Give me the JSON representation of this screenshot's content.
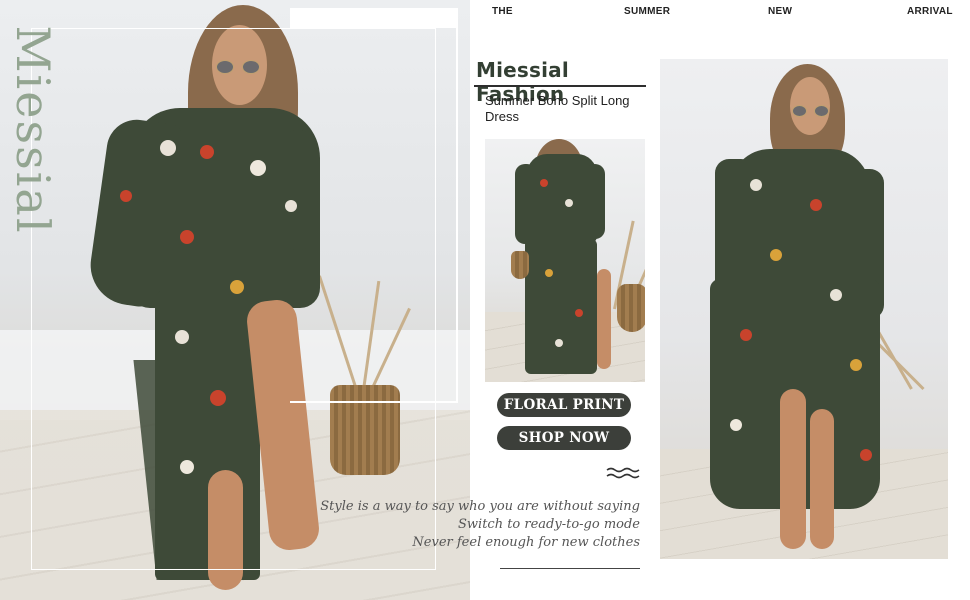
{
  "brand": {
    "vertical_text": "Miessial",
    "title": "Miessial Fashion",
    "subtitle": "Summer Boho Split Long Dress"
  },
  "nav": {
    "items": [
      "THE",
      "SUMMER",
      "NEW",
      "ARRIVAL"
    ]
  },
  "buttons": {
    "floral_print": "FLORAL PRINT",
    "shop_now": "SHOP NOW"
  },
  "quotes": [
    "Style is a way to say who you are without saying",
    "Switch to ready-to-go mode",
    "Never feel enough for new clothes"
  ],
  "icons": {
    "wave": "wave-icon"
  },
  "colors": {
    "brand_sage": "#93a591",
    "dress_green": "#3e4a38",
    "pill_dark": "#3c3f3a"
  }
}
